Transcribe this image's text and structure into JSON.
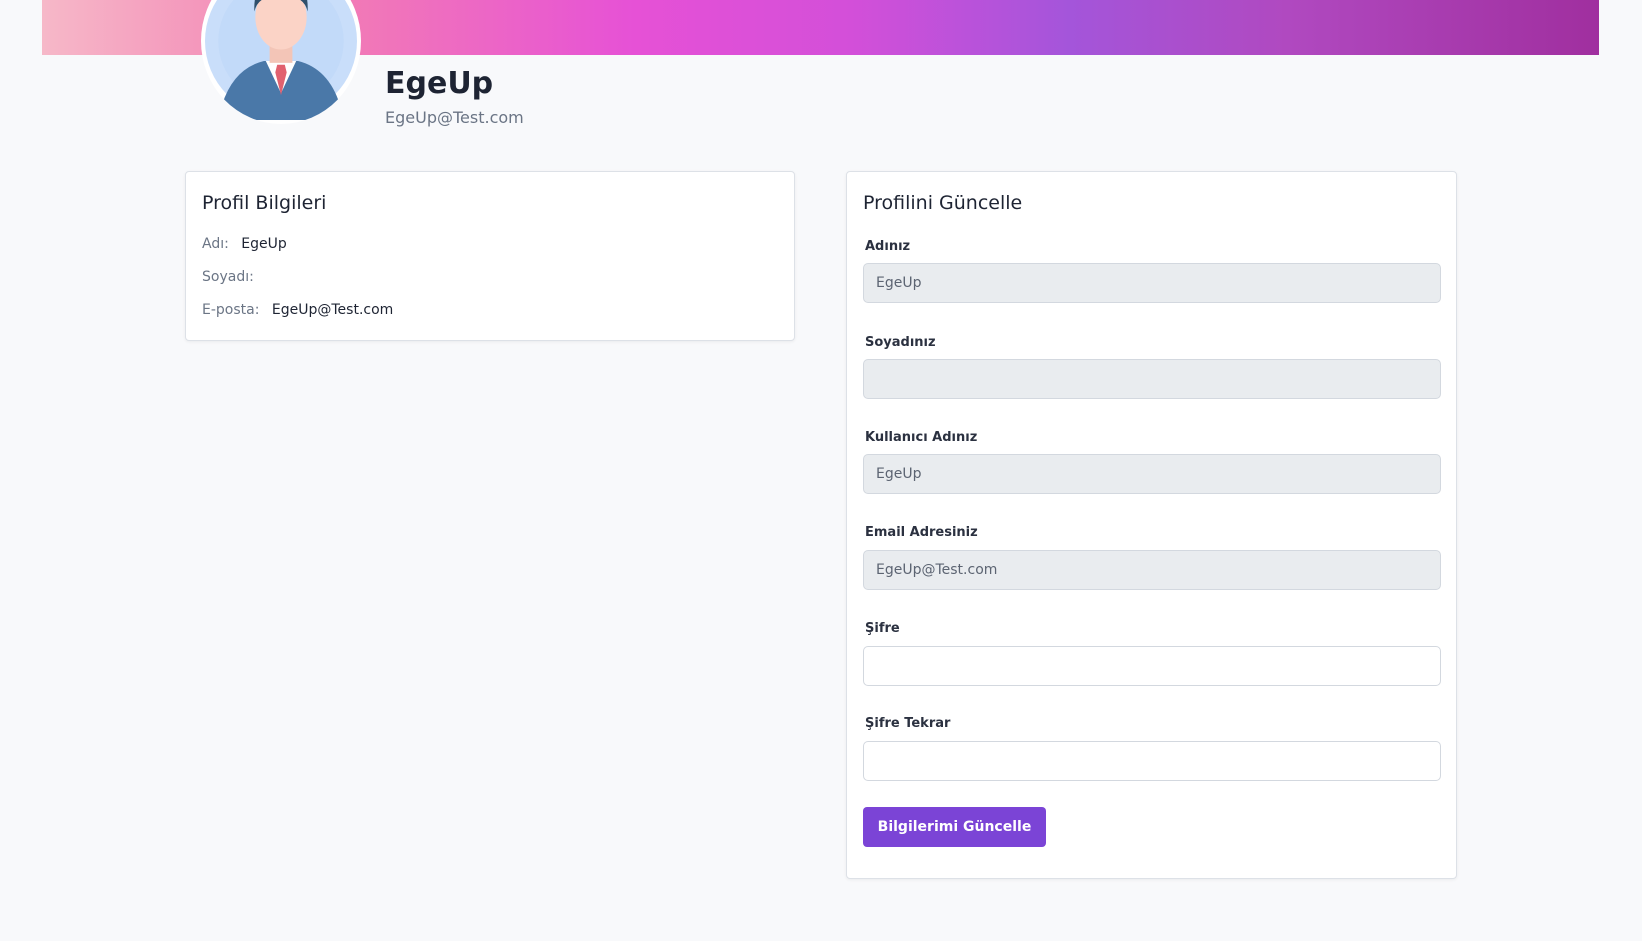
{
  "header": {
    "user_name": "EgeUp",
    "user_email": "EgeUp@Test.com",
    "avatar_icon": "person-avatar-icon"
  },
  "profile_info": {
    "title": "Profil Bilgileri",
    "rows": [
      {
        "label": "Adı:",
        "value": "EgeUp"
      },
      {
        "label": "Soyadı:",
        "value": ""
      },
      {
        "label": "E-posta:",
        "value": "EgeUp@Test.com"
      }
    ]
  },
  "update_form": {
    "title": "Profilini Güncelle",
    "fields": [
      {
        "label": "Adınız",
        "value": "EgeUp",
        "disabled": true
      },
      {
        "label": "Soyadınız",
        "value": "",
        "disabled": true
      },
      {
        "label": "Kullanıcı Adınız",
        "value": "EgeUp",
        "disabled": true
      },
      {
        "label": "Email Adresiniz",
        "value": "EgeUp@Test.com",
        "disabled": true
      },
      {
        "label": "Şifre",
        "value": "",
        "disabled": false
      },
      {
        "label": "Şifre Tekrar",
        "value": "",
        "disabled": false
      }
    ],
    "submit_label": "Bilgilerimi Güncelle"
  },
  "colors": {
    "accent": "#7b44d6",
    "page_background": "#f8f9fb",
    "disabled_input": "#e9ecef"
  }
}
